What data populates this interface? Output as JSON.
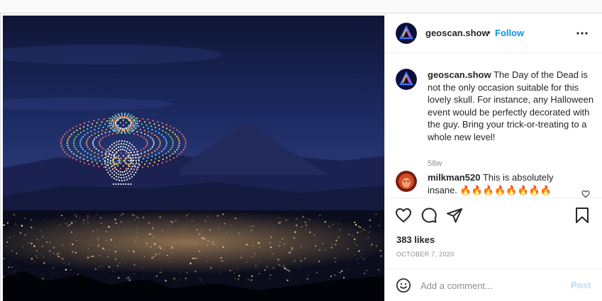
{
  "header": {
    "username": "geoscan.show",
    "separator": "•",
    "follow_label": "Follow",
    "more_icon": "more-options-icon"
  },
  "caption": {
    "username": "geoscan.show",
    "text": "The Day of the Dead is not the only occasion suitable for this lovely skull. For instance, any Halloween event would be perfectly decorated with the guy. Bring your trick-or-treating to a whole new level!",
    "time": "58w"
  },
  "comment": {
    "username": "milkman520",
    "text": "This is absolutely insane. 🔥🔥🔥🔥🔥🔥🔥🔥"
  },
  "actions": {
    "like_icon": "heart-icon",
    "comment_icon": "comment-icon",
    "share_icon": "share-icon",
    "save_icon": "bookmark-icon"
  },
  "likes": "383 likes",
  "date": "OCTOBER 7, 2020",
  "add_comment": {
    "placeholder": "Add a comment...",
    "post_label": "Post"
  },
  "colors": {
    "accent": "#0095f6",
    "post_disabled": "#b3dbff",
    "muted": "#8e8e8e"
  }
}
